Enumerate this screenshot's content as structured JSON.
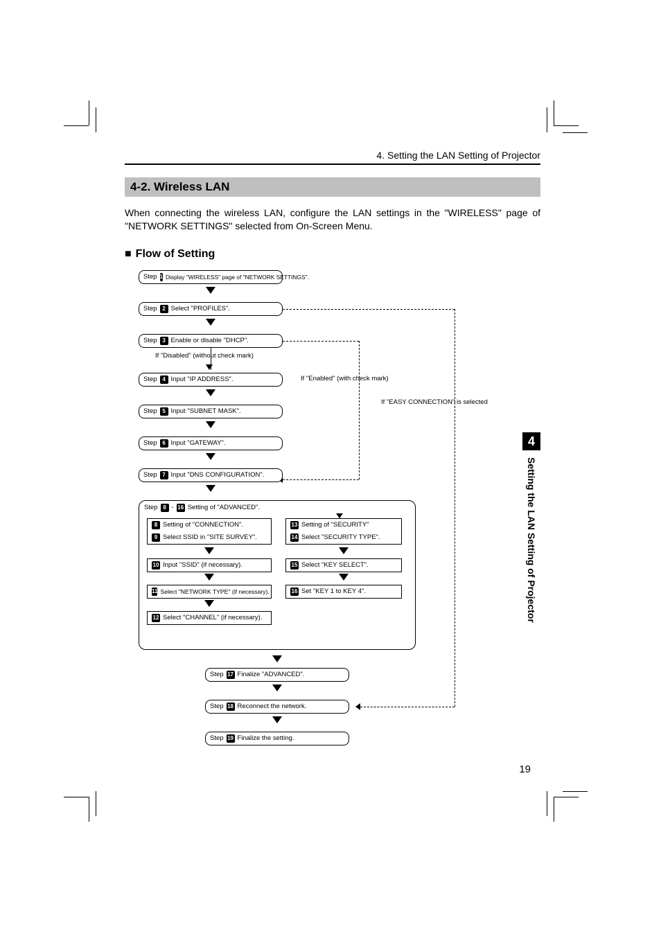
{
  "chapter_header": "4. Setting the LAN Setting of Projector",
  "section_title": "4-2.  Wireless LAN",
  "intro_text": "When connecting the wireless LAN, configure the LAN settings in the \"WIRELESS\" page of \"NETWORK SETTINGS\" selected from On-Screen Menu.",
  "subsection_title": "Flow of Setting",
  "side_tab_number": "4",
  "side_tab_text": "Setting the LAN Setting of Projector",
  "page_number": "19",
  "flow": {
    "step_label": "Step",
    "steps": {
      "s1": "Display \"WIRELESS\" page of \"NETWORK SETTINGS\".",
      "s2": "Select \"PROFILES\".",
      "s3": "Enable or disable \"DHCP\".",
      "s4": "Input \"IP ADDRESS\".",
      "s5": "Input \"SUBNET MASK\".",
      "s6": "Input \"GATEWAY\".",
      "s7": "Input \"DNS CONFIGURATION\".",
      "s8_header": "Setting of \"ADVANCED\".",
      "s8": "Setting of \"CONNECTION\".",
      "s9": "Select SSID in \"SITE SURVEY\".",
      "s10": "Input \"SSID\" (if necessary).",
      "s11": "Select \"NETWORK TYPE\" (if necessary).",
      "s12": "Select \"CHANNEL\" (if necessary).",
      "s13": "Setting of \"SECURITY\"",
      "s14": "Select \"SECURITY TYPE\".",
      "s15": "Select \"KEY SELECT\".",
      "s16": "Set \"KEY 1 to KEY 4\".",
      "s17": "Finalize \"ADVANCED\".",
      "s18": "Reconnect the network.",
      "s19": "Finalize the setting."
    },
    "numbers": {
      "n1": "1",
      "n2": "2",
      "n3": "3",
      "n4": "4",
      "n5": "5",
      "n6": "6",
      "n7": "7",
      "n8": "8",
      "n9": "9",
      "n10": "10",
      "n11": "11",
      "n12": "12",
      "n13": "13",
      "n14": "14",
      "n15": "15",
      "n16": "16",
      "n17": "17",
      "n18": "18",
      "n19": "19"
    },
    "range_dash": " - ",
    "notes": {
      "disabled": "If \"Disabled\" (without check mark)",
      "enabled": "If \"Enabled\" (with check mark)",
      "easy": "If \"EASY CONNECTION\" is selected"
    }
  }
}
